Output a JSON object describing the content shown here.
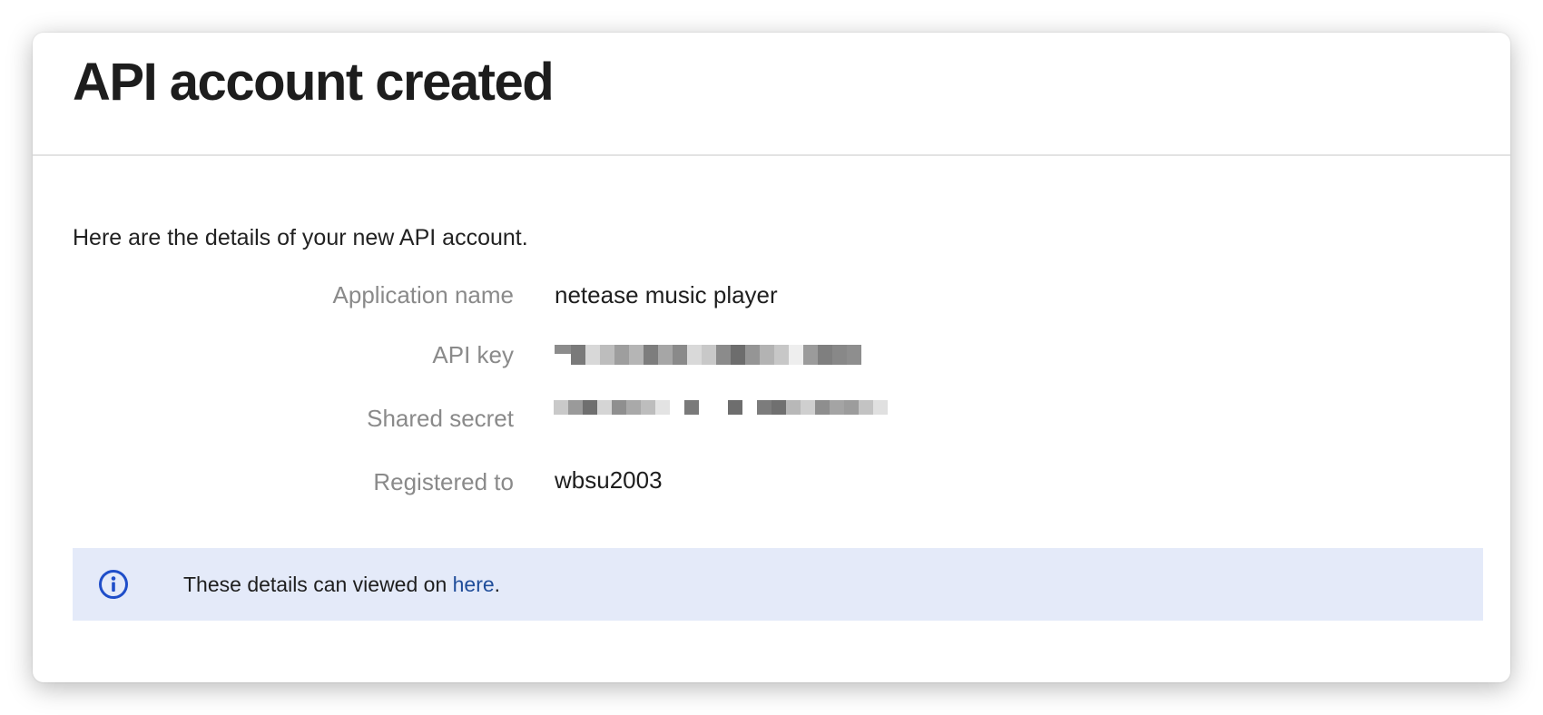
{
  "page": {
    "title": "API account created",
    "intro": "Here are the details of your new API account."
  },
  "details": [
    {
      "label": "Application name",
      "value": "netease music player"
    },
    {
      "label": "API key",
      "value": ""
    },
    {
      "label": "Shared secret",
      "value": ""
    },
    {
      "label": "Registered to",
      "value": "wbsu2003"
    }
  ],
  "info": {
    "text_before": "These details can viewed on ",
    "link": "here",
    "text_after": ".",
    "icon": "info-icon"
  },
  "colors": {
    "info_bg": "#e4eaf9",
    "info_icon": "#1f4ec9",
    "link": "#1f4d9a",
    "label": "#8a8a8a"
  }
}
